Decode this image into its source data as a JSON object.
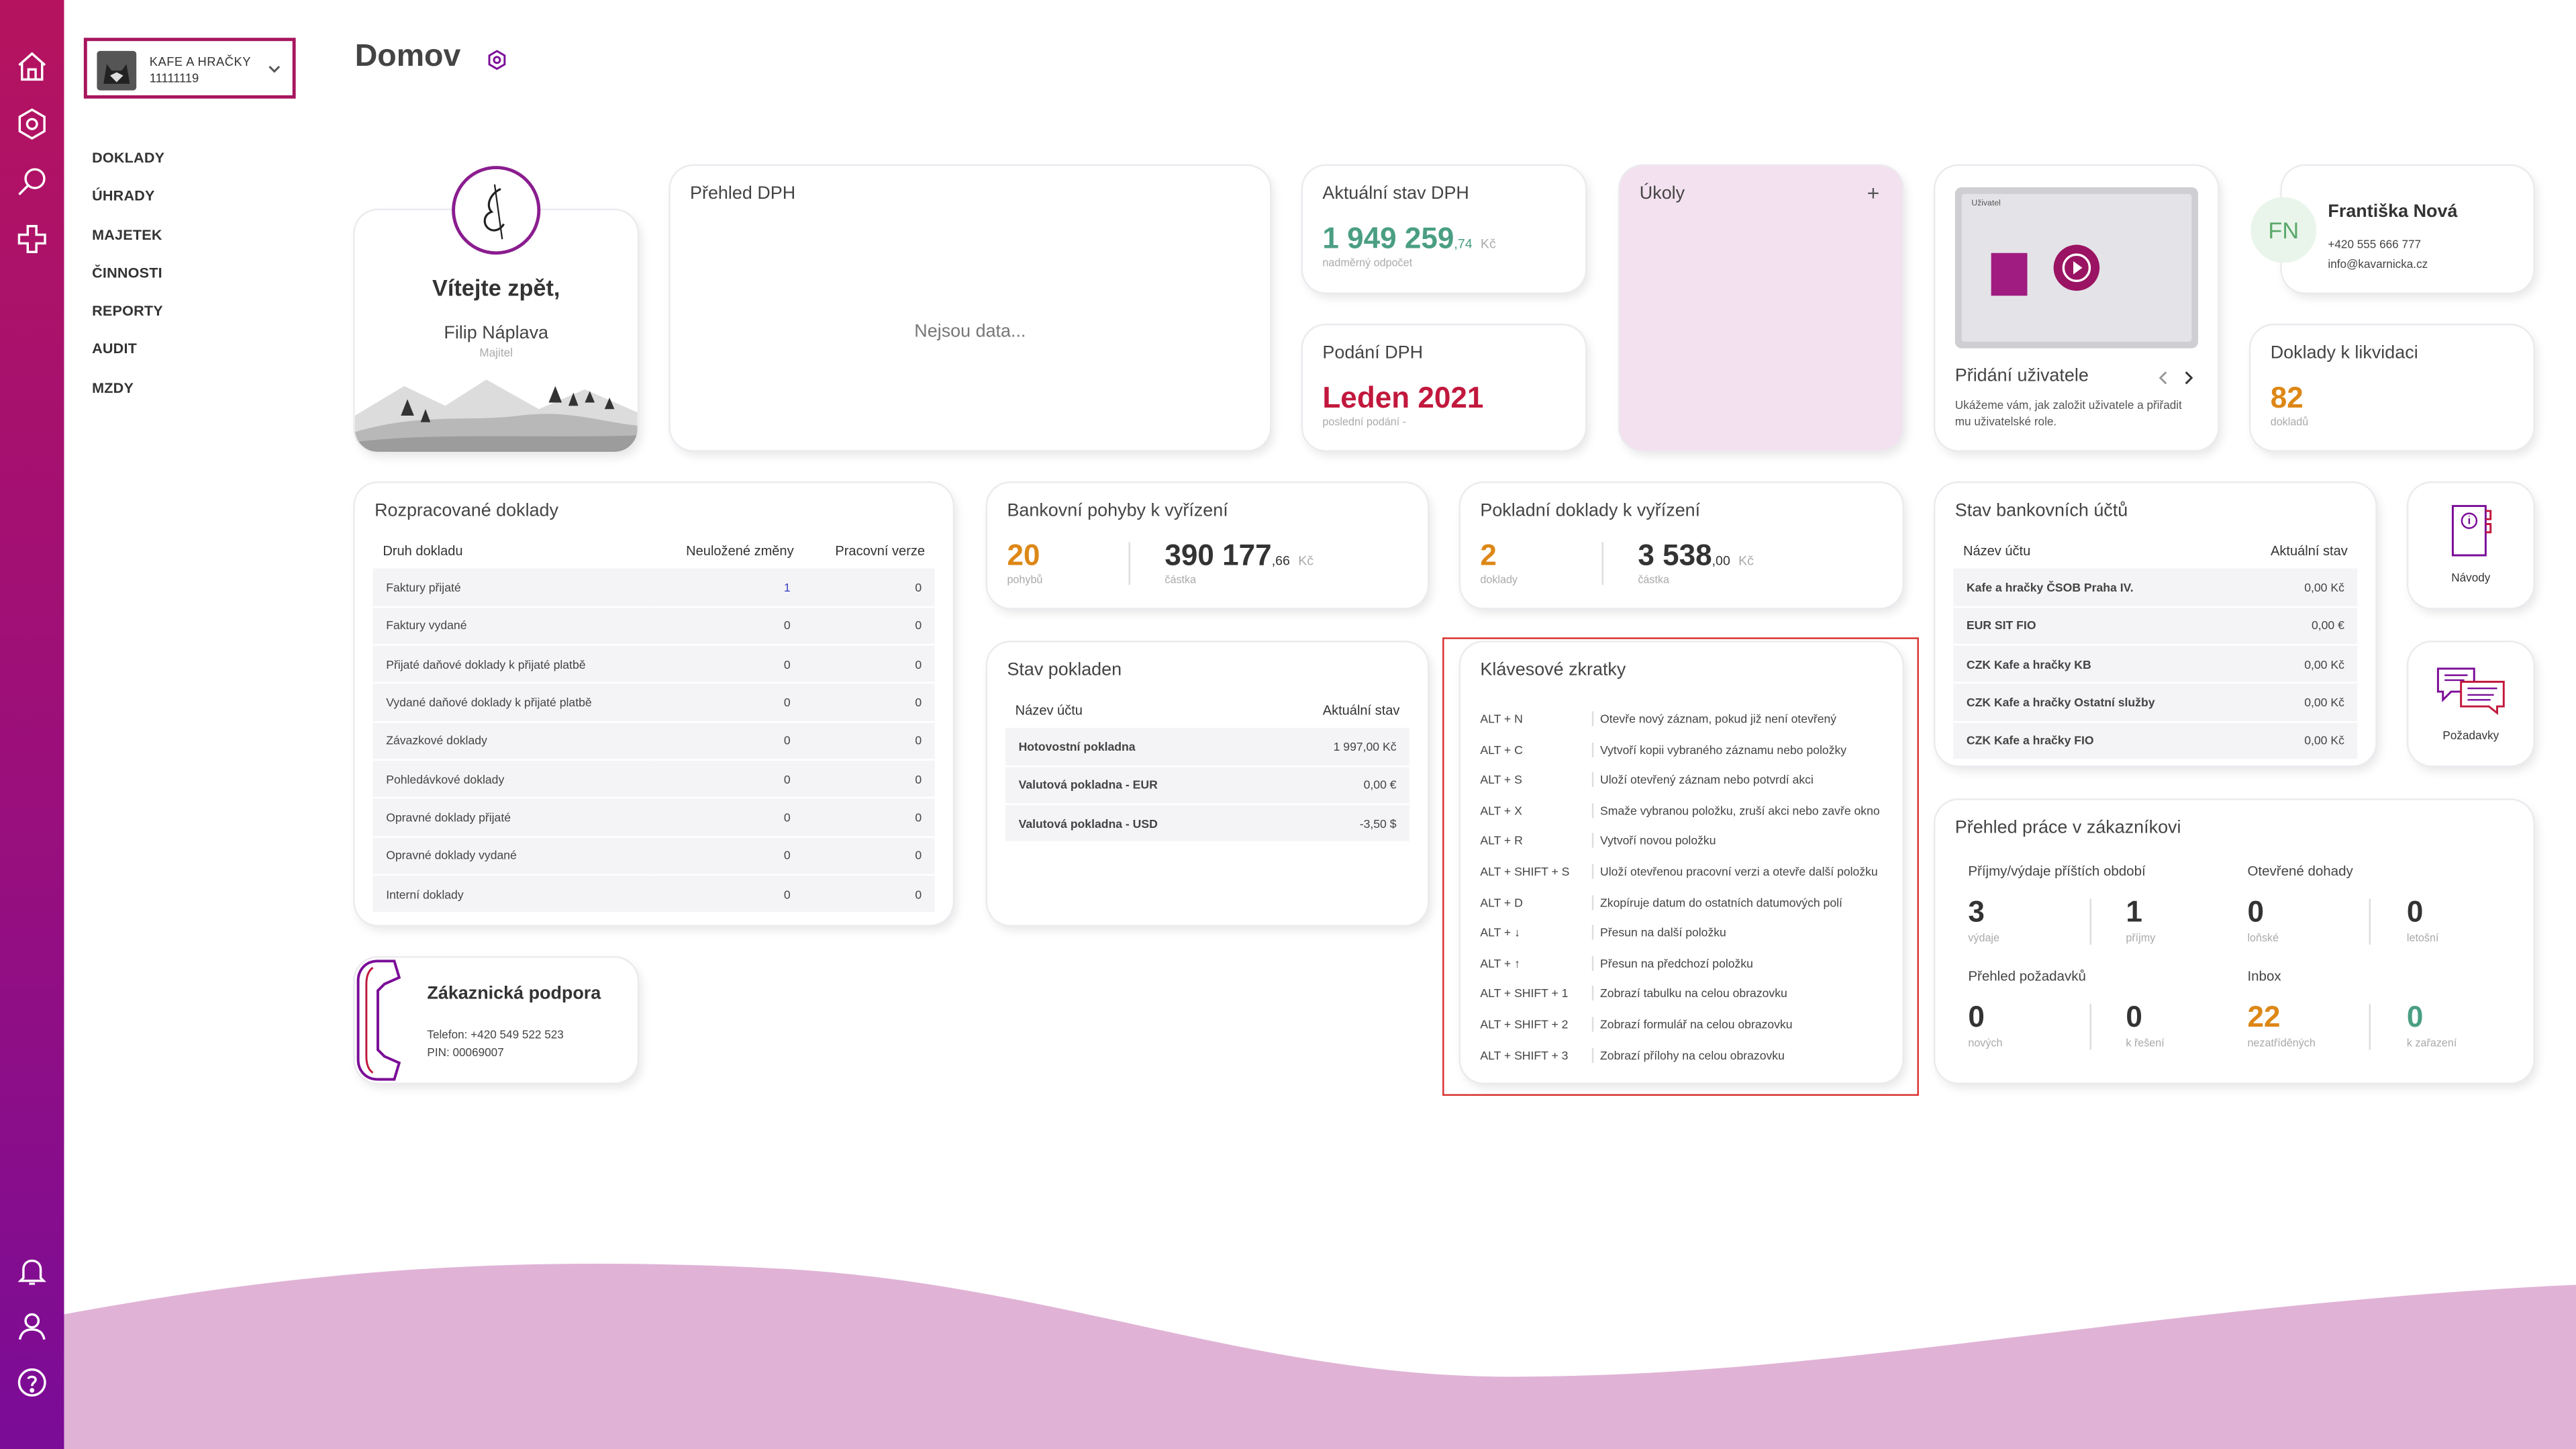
{
  "rail": {
    "accent_top": "#b5135f",
    "accent_bottom": "#7a0c97",
    "top_icons": [
      "home-icon",
      "gear-icon",
      "search-icon",
      "puzzle-icon"
    ],
    "bottom_icons": [
      "bell-icon",
      "user-icon",
      "help-icon"
    ]
  },
  "company": {
    "name": "KAFE A HRAČKY",
    "id": "11111119"
  },
  "nav": [
    "DOKLADY",
    "ÚHRADY",
    "MAJETEK",
    "ČINNOSTI",
    "REPORTY",
    "AUDIT",
    "MZDY"
  ],
  "page": {
    "title": "Domov"
  },
  "welcome": {
    "title": "Vítejte zpět,",
    "name": "Filip Náplava",
    "role": "Majitel"
  },
  "vat_overview": {
    "title": "Přehled DPH",
    "empty": "Nejsou data..."
  },
  "vat_state": {
    "title": "Aktuální stav DPH",
    "value": "1 949 259",
    "decimals": ",74",
    "unit": "Kč",
    "note": "nadměrný odpočet"
  },
  "vat_filing": {
    "title": "Podání DPH",
    "value": "Leden 2021",
    "note": "poslední podání -"
  },
  "tasks": {
    "title": "Úkoly",
    "add": "+"
  },
  "tutorial": {
    "title": "Přidání uživatele",
    "text_line1": "Ukážeme vám, jak založit uživatele a přiřadit",
    "text_line2": "mu uživatelské role.",
    "video_header": "Uživatel"
  },
  "contact": {
    "initials": "FN",
    "name": "Františka Nová",
    "phone": "+420 555 666 777",
    "email": "info@kavarnicka.cz"
  },
  "liquidation": {
    "title": "Doklady k likvidaci",
    "value": "82",
    "note": "dokladů"
  },
  "drafts": {
    "title": "Rozpracované doklady",
    "headers": [
      "Druh dokladu",
      "Neuložené změny",
      "Pracovní verze"
    ],
    "rows": [
      [
        "Faktury přijaté",
        "1",
        "0"
      ],
      [
        "Faktury vydané",
        "0",
        "0"
      ],
      [
        "Přijaté daňové doklady k přijaté platbě",
        "0",
        "0"
      ],
      [
        "Vydané daňové doklady k přijaté platbě",
        "0",
        "0"
      ],
      [
        "Závazkové doklady",
        "0",
        "0"
      ],
      [
        "Pohledávkové doklady",
        "0",
        "0"
      ],
      [
        "Opravné doklady přijaté",
        "0",
        "0"
      ],
      [
        "Opravné doklady vydané",
        "0",
        "0"
      ],
      [
        "Interní doklady",
        "0",
        "0"
      ]
    ]
  },
  "bank_moves": {
    "title": "Bankovní pohyby k vyřízení",
    "count": "20",
    "count_note": "pohybů",
    "amount": "390 177",
    "decimals": ",66",
    "unit": "Kč",
    "amount_note": "částka"
  },
  "cash_docs": {
    "title": "Pokladní doklady k vyřízení",
    "count": "2",
    "count_note": "doklady",
    "amount": "3 538",
    "decimals": ",00",
    "unit": "Kč",
    "amount_note": "částka"
  },
  "cash_state": {
    "title": "Stav pokladen",
    "headers": [
      "Název účtu",
      "Aktuální stav"
    ],
    "rows": [
      [
        "Hotovostní pokladna",
        "1 997,00 Kč"
      ],
      [
        "Valutová pokladna - EUR",
        "0,00 €"
      ],
      [
        "Valutová pokladna - USD",
        "-3,50 $"
      ]
    ]
  },
  "shortcuts": {
    "title": "Klávesové zkratky",
    "items": [
      [
        "ALT + N",
        "Otevře nový záznam, pokud již není otevřený"
      ],
      [
        "ALT + C",
        "Vytvoří kopii vybraného záznamu nebo položky"
      ],
      [
        "ALT + S",
        "Uloží otevřený záznam nebo potvrdí akci"
      ],
      [
        "ALT + X",
        "Smaže vybranou položku, zruší akci nebo zavře okno"
      ],
      [
        "ALT + R",
        "Vytvoří novou položku"
      ],
      [
        "ALT + SHIFT + S",
        "Uloží otevřenou pracovní verzi a otevře další položku"
      ],
      [
        "ALT + D",
        "Zkopíruje datum do ostatních datumových polí"
      ],
      [
        "ALT + ↓",
        "Přesun na další položku"
      ],
      [
        "ALT + ↑",
        "Přesun na předchozí položku"
      ],
      [
        "ALT + SHIFT + 1",
        "Zobrazí tabulku na celou obrazovku"
      ],
      [
        "ALT + SHIFT + 2",
        "Zobrazí formulář na celou obrazovku"
      ],
      [
        "ALT + SHIFT + 3",
        "Zobrazí přílohy na celou obrazovku"
      ]
    ]
  },
  "bank_accounts": {
    "title": "Stav bankovních účtů",
    "headers": [
      "Název účtu",
      "Aktuální stav"
    ],
    "rows": [
      [
        "Kafe a hračky ČSOB Praha IV.",
        "0,00 Kč"
      ],
      [
        "EUR SIT FIO",
        "0,00 €"
      ],
      [
        "CZK Kafe a hračky KB",
        "0,00 Kč"
      ],
      [
        "CZK Kafe a hračky Ostatní služby",
        "0,00 Kč"
      ],
      [
        "CZK Kafe a hračky FIO",
        "0,00 Kč"
      ]
    ]
  },
  "guides": {
    "label": "Návody"
  },
  "requests": {
    "label": "Požadavky"
  },
  "customer_work": {
    "title": "Přehled práce v zákazníkovi",
    "g1_title": "Příjmy/výdaje příštích období",
    "g2_title": "Otevřené dohady",
    "g3_title": "Přehled požadavků",
    "g4_title": "Inbox",
    "stats": [
      {
        "value": "3",
        "note": "výdaje"
      },
      {
        "value": "1",
        "note": "příjmy"
      },
      {
        "value": "0",
        "note": "loňské"
      },
      {
        "value": "0",
        "note": "letošní"
      },
      {
        "value": "0",
        "note": "nových"
      },
      {
        "value": "0",
        "note": "k řešení"
      },
      {
        "value": "22",
        "note": "nezatříděných"
      },
      {
        "value": "0",
        "note": "k zařazení"
      }
    ]
  },
  "support": {
    "title": "Zákaznická podpora",
    "phone": "Telefon: +420 549 522 523",
    "pin": "PIN: 00069007"
  },
  "colors": {
    "wave": "#e0b3d6",
    "highlight_box": "#d9302f"
  }
}
